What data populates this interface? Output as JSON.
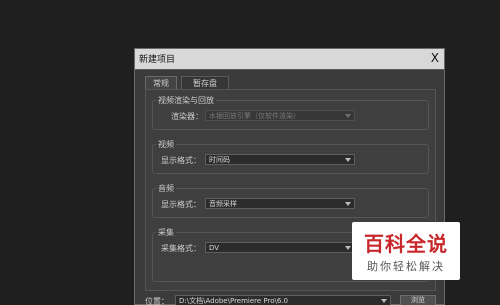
{
  "dialog": {
    "title": "新建项目",
    "close_label": "X"
  },
  "tabs": [
    {
      "label": "常规",
      "active": true
    },
    {
      "label": "暂存盘",
      "active": false
    }
  ],
  "groups": {
    "video_render": {
      "title": "视频渲染与回放",
      "renderer_label": "渲染器：",
      "renderer_value": "水银回放引擎（仅软件渲染）",
      "disabled": true
    },
    "video": {
      "title": "视频",
      "format_label": "显示格式：",
      "format_value": "时间码"
    },
    "audio": {
      "title": "音频",
      "format_label": "显示格式：",
      "format_value": "音频采样"
    },
    "capture": {
      "title": "采集",
      "format_label": "采集格式：",
      "format_value": "DV"
    }
  },
  "location": {
    "label": "位置：",
    "value": "D:\\文档\\Adobe\\Premiere Pro\\6.0",
    "browse_label": "浏览"
  },
  "watermark": {
    "main": "百科全说",
    "sub": "助你轻松解决"
  },
  "colors": {
    "background": "#1f1f1f",
    "dialog": "#3b3b3b",
    "titlebar": "#d8d8d8",
    "watermark_red": "#c8282b"
  }
}
